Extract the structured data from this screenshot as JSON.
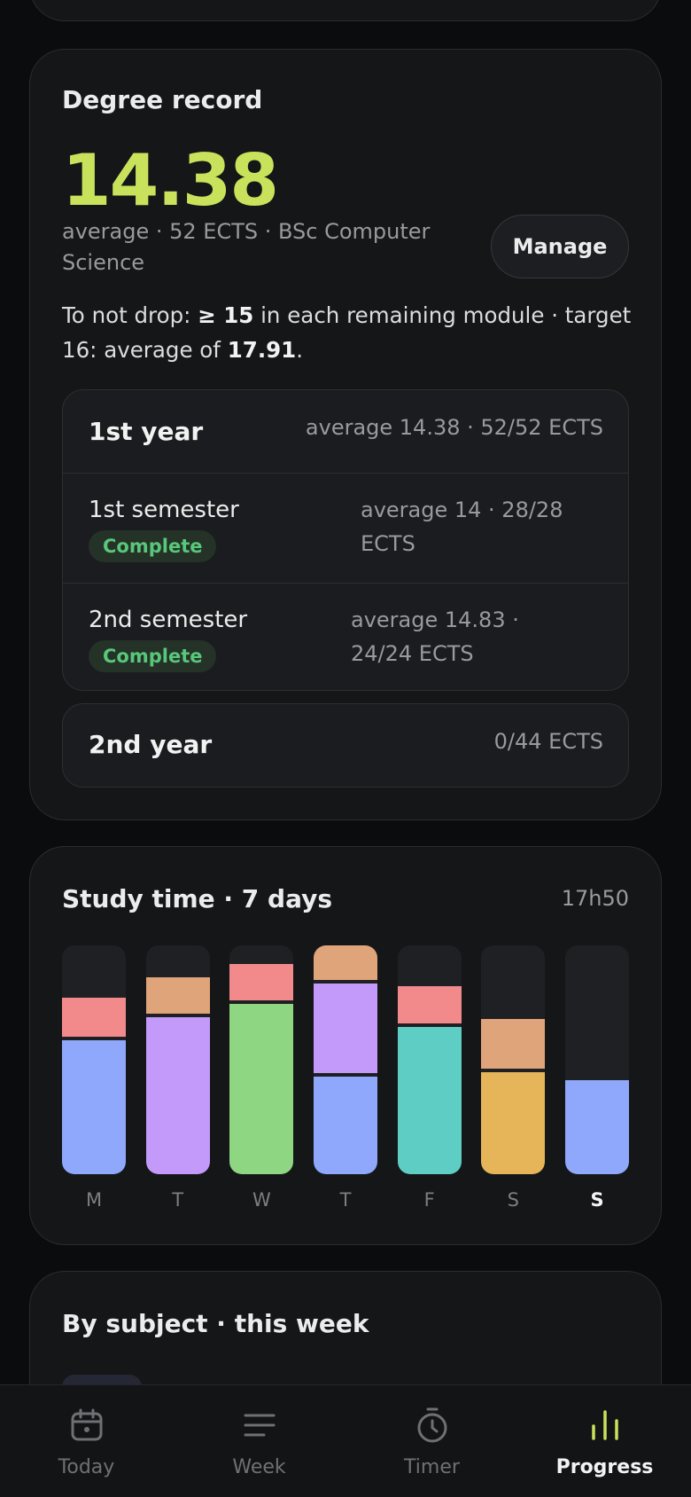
{
  "degree": {
    "title": "Degree record",
    "average": "14.38",
    "summary": "average · 52 ECTS · BSc Computer Science",
    "manage_label": "Manage",
    "drop_prefix": "To not drop: ",
    "drop_threshold": "≥ 15",
    "drop_middle": " in each remaining module · target 16: average of ",
    "drop_target_avg": "17.91",
    "drop_suffix": ".",
    "years": [
      {
        "name": "1st year",
        "meta": "average 14.38 · 52/52 ECTS",
        "semesters": [
          {
            "name": "1st semester",
            "status": "Complete",
            "meta": "average 14 · 28/28 ECTS"
          },
          {
            "name": "2nd semester",
            "status": "Complete",
            "meta": "average 14.83 · 24/24 ECTS"
          }
        ]
      },
      {
        "name": "2nd year",
        "meta": "0/44 ECTS"
      }
    ]
  },
  "study": {
    "title": "Study time · 7 days",
    "total": "17h50"
  },
  "chart_data": {
    "type": "bar",
    "stacked": true,
    "categories": [
      "M",
      "T",
      "W",
      "T",
      "F",
      "S",
      "S"
    ],
    "highlighted_category_index": 6,
    "max_value": 1.0,
    "segments": [
      [
        {
          "value": 0.6,
          "color": "#8fa8fb"
        },
        {
          "value": 0.17,
          "color": "#f28a8c"
        }
      ],
      [
        {
          "value": 0.7,
          "color": "#c39afa"
        },
        {
          "value": 0.16,
          "color": "#e0a47a"
        }
      ],
      [
        {
          "value": 0.76,
          "color": "#8fd683"
        },
        {
          "value": 0.16,
          "color": "#f28a8c"
        }
      ],
      [
        {
          "value": 0.44,
          "color": "#8fa8fb"
        },
        {
          "value": 0.41,
          "color": "#c39afa"
        },
        {
          "value": 0.15,
          "color": "#e0a47a"
        }
      ],
      [
        {
          "value": 0.66,
          "color": "#5ecdc3"
        },
        {
          "value": 0.16,
          "color": "#f28a8c"
        }
      ],
      [
        {
          "value": 0.46,
          "color": "#e6b55a"
        },
        {
          "value": 0.22,
          "color": "#e0a47a"
        }
      ],
      [
        {
          "value": 0.41,
          "color": "#8fa8fb"
        }
      ]
    ]
  },
  "subject": {
    "title": "By subject · this week"
  },
  "nav": {
    "items": [
      {
        "label": "Today",
        "icon": "calendar-icon"
      },
      {
        "label": "Week",
        "icon": "list-icon"
      },
      {
        "label": "Timer",
        "icon": "stopwatch-icon"
      },
      {
        "label": "Progress",
        "icon": "bar-chart-icon"
      }
    ],
    "active_index": 3,
    "accent": "#c9e25c"
  }
}
